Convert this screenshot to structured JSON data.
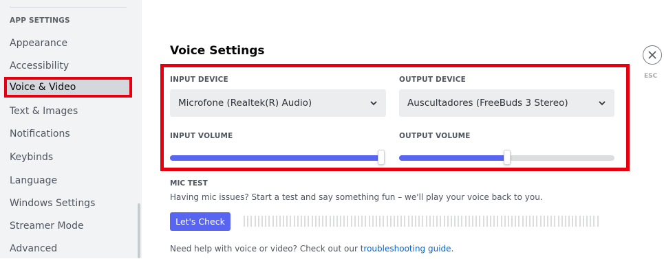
{
  "sidebar": {
    "header": "APP SETTINGS",
    "items": [
      {
        "label": "Appearance"
      },
      {
        "label": "Accessibility"
      },
      {
        "label": "Voice & Video"
      },
      {
        "label": "Text & Images"
      },
      {
        "label": "Notifications"
      },
      {
        "label": "Keybinds"
      },
      {
        "label": "Language"
      },
      {
        "label": "Windows Settings"
      },
      {
        "label": "Streamer Mode"
      },
      {
        "label": "Advanced"
      }
    ],
    "selected": "Voice & Video"
  },
  "main": {
    "title": "Voice Settings",
    "close_icon": "close-icon",
    "esc_label": "ESC",
    "input_device": {
      "label": "INPUT DEVICE",
      "value": "Microfone (Realtek(R) Audio)"
    },
    "output_device": {
      "label": "OUTPUT DEVICE",
      "value": "Auscultadores (FreeBuds 3 Stereo)"
    },
    "input_volume": {
      "label": "INPUT VOLUME",
      "level": 1.0
    },
    "output_volume": {
      "label": "OUTPUT VOLUME",
      "level": 0.5
    },
    "mic_test": {
      "label": "MIC TEST",
      "description": "Having mic issues? Start a test and say something fun – we'll play your voice back to you.",
      "button": "Let's Check"
    },
    "help": {
      "prefix": "Need help with voice or video? Check out our ",
      "link": "troubleshooting guide",
      "suffix": "."
    }
  },
  "colors": {
    "accent": "#5865f2",
    "highlight_red": "#e6000f",
    "link": "#0067e0"
  }
}
